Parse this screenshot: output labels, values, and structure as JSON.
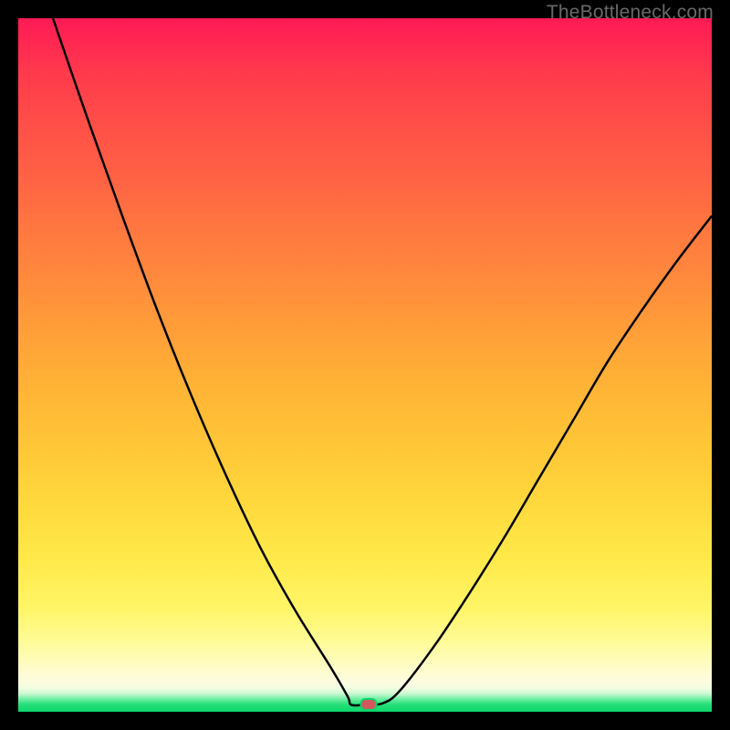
{
  "watermark": {
    "text": "TheBottleneck.com"
  },
  "chart_data": {
    "type": "line",
    "title": "",
    "xlabel": "",
    "ylabel": "",
    "xlim": [
      0,
      100
    ],
    "ylim": [
      0,
      100
    ],
    "grid": false,
    "legend": false,
    "series": [
      {
        "name": "bottleneck-curve",
        "x": [
          5,
          10,
          15,
          20,
          25,
          30,
          35,
          40,
          45,
          47.5,
          48,
          50,
          52.5,
          55,
          60,
          65,
          70,
          75,
          80,
          85,
          90,
          95,
          100
        ],
        "values": [
          100,
          85.5,
          71.5,
          58.0,
          45.5,
          34.0,
          23.5,
          14.5,
          6.5,
          2.2,
          1.0,
          1.0,
          1.2,
          3.0,
          9.5,
          17.0,
          25.0,
          33.5,
          42.0,
          50.5,
          58.0,
          65.0,
          71.5
        ]
      }
    ],
    "marker": {
      "name": "optimal-point",
      "x": 50.5,
      "y": 1.0,
      "color": "#cf595d"
    },
    "background_gradient": {
      "top": "#ff1a56",
      "bottom": "#0ad66a"
    }
  }
}
